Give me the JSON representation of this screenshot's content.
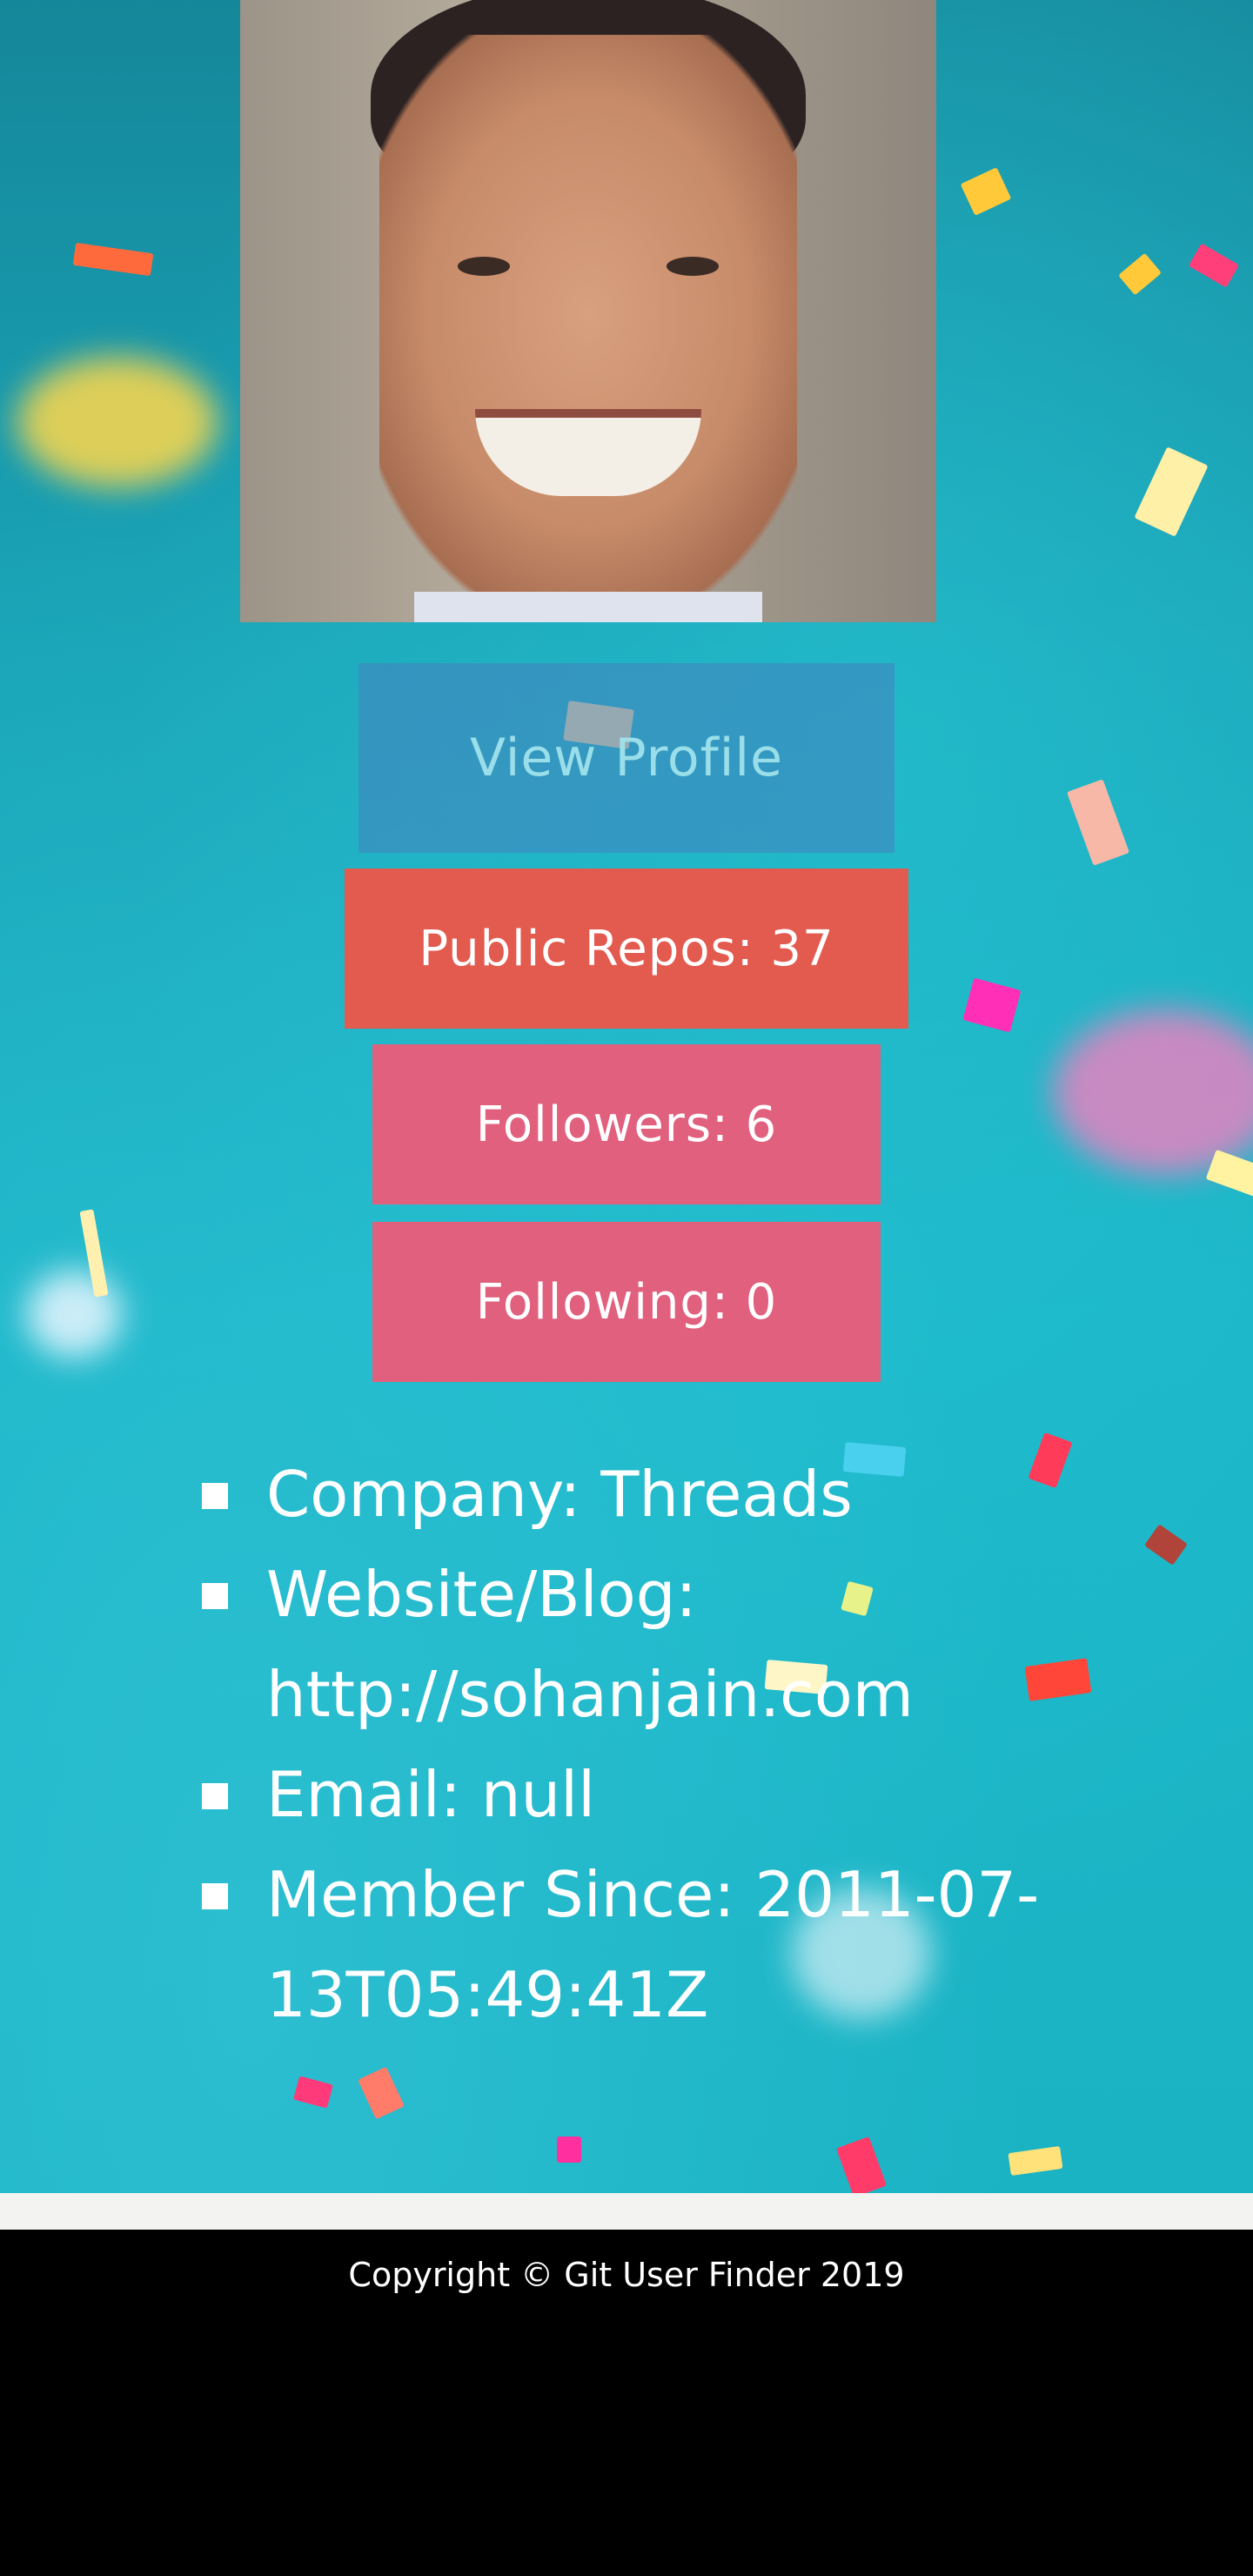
{
  "profile": {
    "avatar_alt": "",
    "view_profile_label": "View Profile"
  },
  "stats": {
    "public_repos": "Public Repos: 37",
    "followers": "Followers: 6",
    "following": "Following: 0"
  },
  "details": [
    {
      "text": "Company: Threads"
    },
    {
      "text": "Website/Blog: http://sohanjain.com"
    },
    {
      "text": "Email: null"
    },
    {
      "text": "Member Since: 2011-07-13T05:49:41Z"
    }
  ],
  "footer": {
    "copyright": "Copyright © Git User Finder 2019"
  },
  "colors": {
    "background": "#1ab3c4",
    "repos_button": "#e35a4f",
    "followers_button": "#e0607e",
    "view_profile_button": "#4682be",
    "footer": "#000000"
  }
}
